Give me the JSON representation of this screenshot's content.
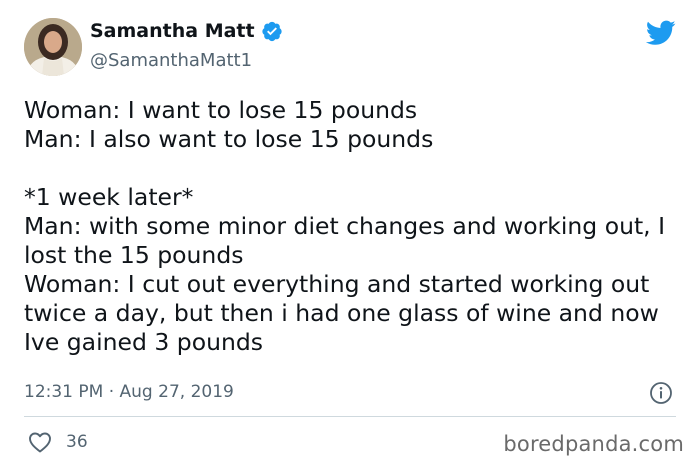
{
  "author": {
    "display_name": "Samantha Matt",
    "handle": "@SamanthaMatt1",
    "verified": true
  },
  "tweet": {
    "text": "Woman: I want to lose 15 pounds\nMan: I also want to lose 15 pounds\n\n*1 week later*\nMan: with some minor diet changes and working out, I lost the 15 pounds\nWoman: I cut out everything and started working out twice a day, but then i had one glass of wine and now Ive gained 3 pounds",
    "timestamp": "12:31 PM · Aug 27, 2019",
    "like_count": "36"
  },
  "watermark": "boredpanda.com",
  "icons": {
    "brand": "twitter-bird-icon",
    "verified": "verified-badge-icon",
    "info": "info-icon",
    "like": "heart-icon"
  },
  "colors": {
    "twitter_blue": "#1d9bf0",
    "secondary_text": "#536471"
  }
}
